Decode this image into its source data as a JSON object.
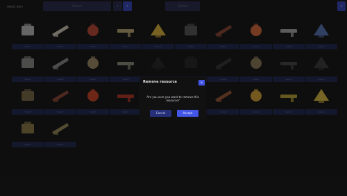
{
  "header": {
    "title": "Select Item",
    "search_placeholder": "Search",
    "filter_icon": "chevron-down-icon",
    "add_icon": "plus-icon",
    "upload_label": "Upload",
    "corner_icon": "close-icon"
  },
  "grid": {
    "select_label": "Select",
    "items": [
      {
        "icon": "tripod-item",
        "color": "#b8b8bb"
      },
      {
        "icon": "blade-item",
        "color": "#cfc7b5"
      },
      {
        "icon": "red-tool-item",
        "color": "#b84c3a"
      },
      {
        "icon": "gear-pack-item",
        "color": "#b9a676"
      },
      {
        "icon": "yellow-device-item",
        "color": "#d9b33e"
      },
      {
        "icon": "pistol-item",
        "color": "#5a5a5c"
      },
      {
        "icon": "lever-item",
        "color": "#8c4a3a"
      },
      {
        "icon": "orange-parts-item",
        "color": "#d36a3f"
      },
      {
        "icon": "wrench-item",
        "color": "#a8a8aa"
      },
      {
        "icon": "blue-device-item",
        "color": "#5a77b4"
      },
      {
        "icon": "machine-part-item",
        "color": "#8a8a88"
      },
      {
        "icon": "tube-item",
        "color": "#8a8a8a"
      },
      {
        "icon": "rifle-item",
        "color": "#9e8a64"
      },
      {
        "icon": "launcher-item",
        "color": "#8d8d7a"
      },
      {
        "icon": "hidden-item",
        "color": "#2a2a2a"
      },
      {
        "icon": "hidden-item-2",
        "color": "#2a2a2a"
      },
      {
        "icon": "dark-figure-item",
        "color": "#3a3a3a"
      },
      {
        "icon": "ammo-clip-item",
        "color": "#8a7a5a"
      },
      {
        "icon": "dark-cube-item",
        "color": "#4a4a4a"
      },
      {
        "icon": "dark-tool-item",
        "color": "#3e3e3e"
      },
      {
        "icon": "crate-item",
        "color": "#7a6a4a"
      },
      {
        "icon": "knife-item",
        "color": "#8a4a3a"
      },
      {
        "icon": "red-fuel-item",
        "color": "#c7472a"
      },
      {
        "icon": "red-gear-item",
        "color": "#b33a2a"
      },
      {
        "icon": "lamp-item",
        "color": "#9a3a2a"
      },
      {
        "icon": "stick-item",
        "color": "#6a6a6a"
      },
      {
        "icon": "brown-drill-item",
        "color": "#9a5a3a"
      },
      {
        "icon": "yellow-gun-item",
        "color": "#d2a33a"
      },
      {
        "icon": "camo-item",
        "color": "#b6a23a"
      },
      {
        "icon": "yellow-scope-item",
        "color": "#d8b842"
      },
      {
        "icon": "spiky-item",
        "color": "#8a7a4a"
      },
      {
        "icon": "long-rifle-item",
        "color": "#9a8a5a"
      }
    ]
  },
  "modal": {
    "title": "Remove resource",
    "close_label": "×",
    "message": "Are you sure you want to remove this resource?",
    "cancel_label": "Cancel",
    "accept_label": "Accept"
  }
}
